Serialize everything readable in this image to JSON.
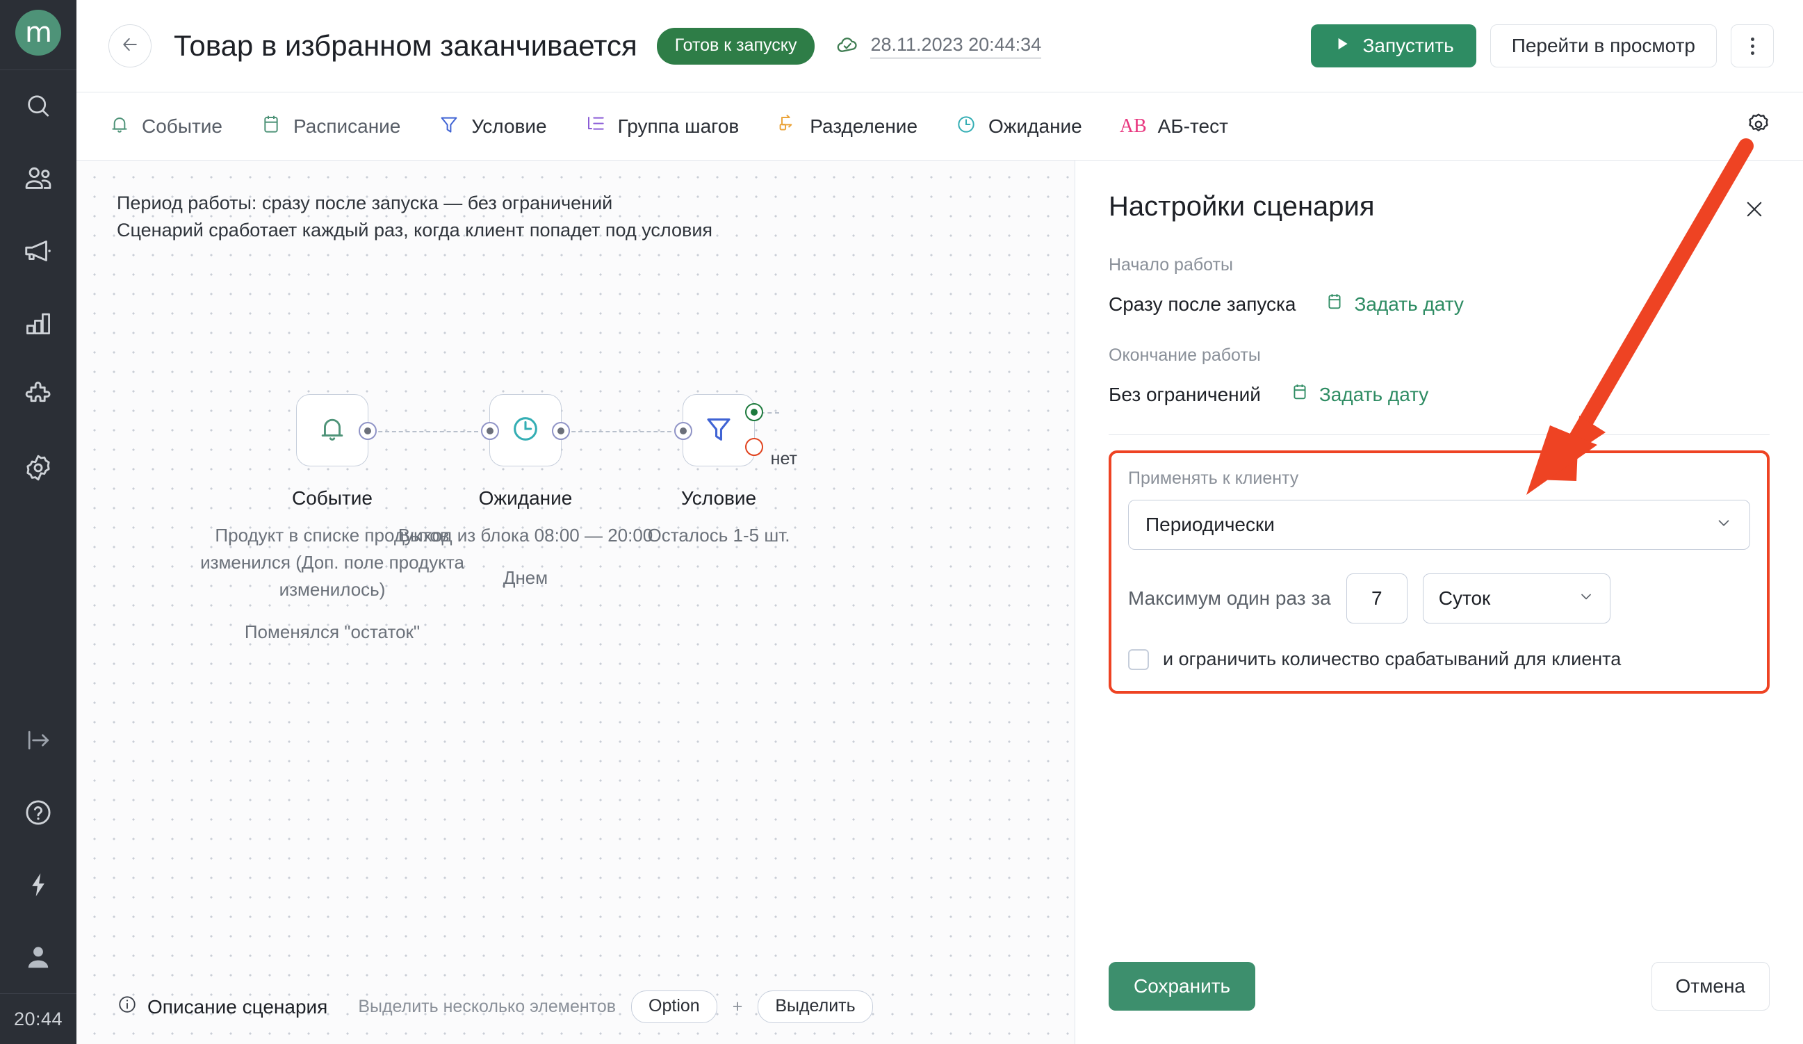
{
  "colors": {
    "brand_green": "#2e8c63",
    "badge_green": "#2e7d47",
    "rail_dark": "#2b2f36",
    "annotation_red": "#ee4323",
    "canvas_bg": "#fbfbfc"
  },
  "rail": {
    "logo_text": "m",
    "items": [
      {
        "name": "search-icon",
        "label": "Поиск"
      },
      {
        "name": "users-icon",
        "label": "Клиенты"
      },
      {
        "name": "megaphone-icon",
        "label": "Рассылки"
      },
      {
        "name": "bar-chart-icon",
        "label": "Аналитика"
      },
      {
        "name": "puzzle-icon",
        "label": "Интеграции"
      },
      {
        "name": "gear-icon",
        "label": "Настройки"
      }
    ],
    "bottom_items": [
      {
        "name": "logout-icon",
        "label": "Выход"
      },
      {
        "name": "help-icon",
        "label": "Помощь"
      },
      {
        "name": "bolt-icon",
        "label": "Быстрые действия"
      },
      {
        "name": "account-icon",
        "label": "Аккаунт"
      }
    ],
    "clock": "20:44"
  },
  "header": {
    "back_label": "Назад",
    "title": "Товар в избранном заканчивается",
    "status_badge": "Готов к запуску",
    "saved_icon": "cloud-check-icon",
    "saved_at": "28.11.2023 20:44:34",
    "run_button": "Запустить",
    "preview_button": "Перейти в просмотр",
    "more_button": "Ещё"
  },
  "toolbar": {
    "items": [
      {
        "label": "Событие",
        "icon": "bell-icon",
        "color": "#4e9378"
      },
      {
        "label": "Расписание",
        "icon": "calendar-icon",
        "color": "#4e9378"
      },
      {
        "label": "Условие",
        "icon": "filter-icon",
        "color": "#3f63d4"
      },
      {
        "label": "Группа шагов",
        "icon": "steps-group-icon",
        "color": "#8b5cd6"
      },
      {
        "label": "Разделение",
        "icon": "split-icon",
        "color": "#eba43a"
      },
      {
        "label": "Ожидание",
        "icon": "clock-icon",
        "color": "#34aeb4"
      },
      {
        "label": "АБ-тест",
        "icon": "ab-test-icon",
        "color": "#e8377f"
      }
    ],
    "settings_icon": "gear-icon"
  },
  "canvas": {
    "note_line1": "Период работы: сразу после запуска — без ограничений",
    "note_line2": "Сценарий сработает каждый раз, когда клиент попадет под условия",
    "nodes": [
      {
        "title": "Событие",
        "icon": "bell-icon",
        "sub": "Продукт в списке продуктов изменился (Доп. поле продукта изменилось)",
        "sub2": "Поменялся \"остаток\""
      },
      {
        "title": "Ожидание",
        "icon": "clock-icon",
        "sub": "Выход из блока 08:00 — 20:00",
        "sub2": "Днем"
      },
      {
        "title": "Условие",
        "icon": "filter-icon",
        "sub": "Осталось 1-5 шт.",
        "sub2": "",
        "no_label": "нет"
      }
    ],
    "footer": {
      "description_link": "Описание сценария",
      "hint": "Выделить несколько элементов",
      "key1": "Option",
      "plus": "+",
      "key2": "Выделить"
    }
  },
  "panel": {
    "title": "Настройки сценария",
    "close_label": "Закрыть",
    "start_label": "Начало работы",
    "start_value": "Сразу после запуска",
    "start_set_date": "Задать дату",
    "end_label": "Окончание работы",
    "end_value": "Без ограничений",
    "end_set_date": "Задать дату",
    "apply_label": "Применять к клиенту",
    "apply_value": "Периодически",
    "max_once_label": "Максимум один раз за",
    "max_once_number": "7",
    "max_once_unit": "Суток",
    "limit_checkbox_label": "и ограничить количество срабатываний для клиента",
    "limit_checked": false,
    "save_button": "Сохранить",
    "cancel_button": "Отмена"
  }
}
